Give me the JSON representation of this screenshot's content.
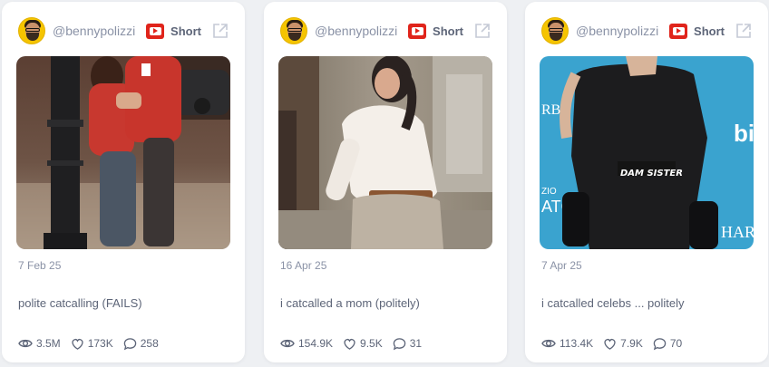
{
  "cards": [
    {
      "handle": "@bennypolizzi",
      "platform_label": "Short",
      "date": "7 Feb 25",
      "title": "polite catcalling (FAILS)",
      "views": "3.5M",
      "likes": "173K",
      "comments": "258"
    },
    {
      "handle": "@bennypolizzi",
      "platform_label": "Short",
      "date": "16 Apr 25",
      "title": "i catcalled a mom (politely)",
      "views": "154.9K",
      "likes": "9.5K",
      "comments": "31"
    },
    {
      "handle": "@bennypolizzi",
      "platform_label": "Short",
      "date": "7 Apr 25",
      "title": "i catcalled celebs ... politely",
      "views": "113.4K",
      "likes": "7.9K",
      "comments": "70",
      "thumbnail_caption": "DAM SISTER",
      "backdrop_letters": {
        "left_top": "RBC",
        "left_mid": "ZIO",
        "left_low": "ATC",
        "right_top": "bi",
        "right_low": "HAR"
      }
    }
  ],
  "icons": {
    "platform": "youtube-icon",
    "external": "external-link-icon",
    "views": "eye-icon",
    "likes": "heart-icon",
    "comments": "comment-icon"
  },
  "colors": {
    "youtube_red": "#e0241b",
    "card_bg": "#ffffff",
    "page_bg": "#eef0f3",
    "muted_text": "#8a92a6"
  }
}
